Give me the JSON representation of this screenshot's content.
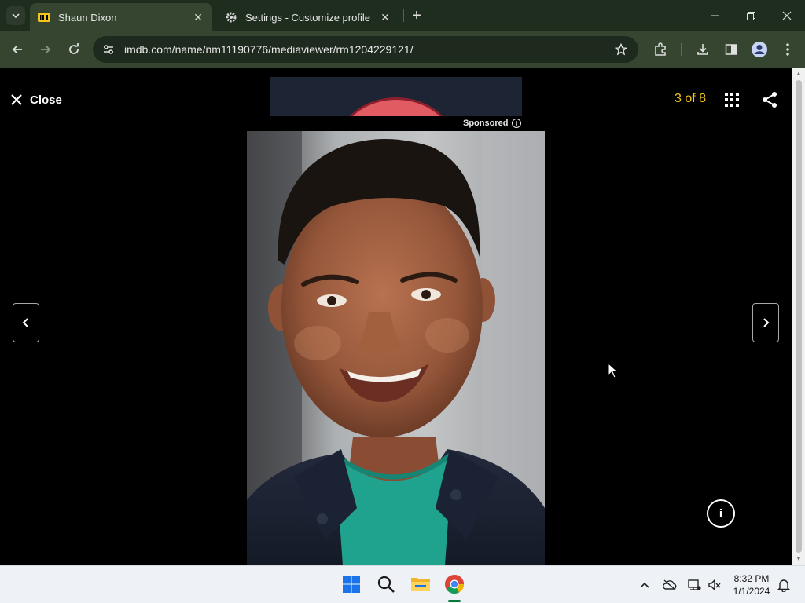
{
  "browser": {
    "tabs": [
      {
        "title": "Shaun Dixon",
        "favicon": "imdb-icon",
        "active": true
      },
      {
        "title": "Settings - Customize profile",
        "favicon": "gear-icon",
        "active": false
      }
    ],
    "url": "imdb.com/name/nm11190776/mediaviewer/rm1204229121/"
  },
  "viewer": {
    "close_label": "Close",
    "counter": "3 of 8",
    "sponsored_label": "Sponsored",
    "sponsored_info": "i",
    "info_label": "i",
    "accent_color": "#f5c518"
  },
  "taskbar": {
    "time": "8:32 PM",
    "date": "1/1/2024"
  }
}
